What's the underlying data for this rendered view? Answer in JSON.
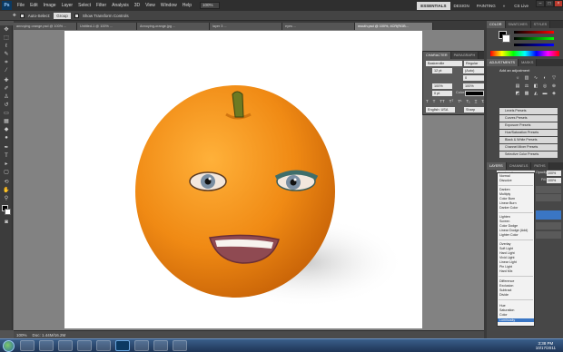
{
  "menu": {
    "app_logo": "Ps",
    "items": [
      "File",
      "Edit",
      "Image",
      "Layer",
      "Select",
      "Filter",
      "Analysis",
      "3D",
      "View",
      "Window",
      "Help"
    ],
    "zoom": "100%",
    "workspaces": [
      "ESSENTIALS",
      "DESIGN",
      "PAINTING"
    ],
    "cs_live": "CS Live"
  },
  "options": {
    "auto_select_label": "Auto-Select:",
    "auto_select_value": "Group",
    "show_transform": "Show Transform Controls"
  },
  "tabs": [
    "annoying orange.psd @ 100% ...",
    "Untitled-1 @ 100% ...",
    "Annoying-orange.jpg ...",
    "layer 3 ...",
    "eyes ...",
    "mouth.psd @ 100%, 4CR(RGB..."
  ],
  "status": {
    "zoom": "100%",
    "doc": "Doc: 1.44M/16.2M"
  },
  "panels": {
    "color_tabs": [
      "COLOR",
      "SWATCHES",
      "STYLES"
    ],
    "adjustments_tabs": [
      "ADJUSTMENTS",
      "MASKS"
    ],
    "adjustments_title": "Add an adjustment",
    "presets": [
      "Levels Presets",
      "Curves Presets",
      "Exposure Presets",
      "Hue/Saturation Presets",
      "Black & White Presets",
      "Channel Mixer Presets",
      "Selective Color Presets"
    ],
    "layers_tabs": [
      "LAYERS",
      "CHANNELS",
      "PATHS"
    ],
    "blend_current": "Luminosity",
    "opacity_label": "Opacity:",
    "opacity_value": "100%",
    "fill_label": "Fill:",
    "fill_value": "100%"
  },
  "character": {
    "tabs": [
      "CHARACTER",
      "PARAGRAPH"
    ],
    "font": "Baskerville",
    "style": "Regular",
    "size": "12 pt",
    "leading": "(Auto)",
    "tracking": "0",
    "scale_v": "100%",
    "scale_h": "100%",
    "baseline": "0 pt",
    "color_label": "Color:",
    "language": "English: USA",
    "aa": "Sharp"
  },
  "blend_modes": [
    [
      "Normal",
      "Dissolve"
    ],
    [
      "Darken",
      "Multiply",
      "Color Burn",
      "Linear Burn",
      "Darker Color"
    ],
    [
      "Lighten",
      "Screen",
      "Color Dodge",
      "Linear Dodge (Add)",
      "Lighter Color"
    ],
    [
      "Overlay",
      "Soft Light",
      "Hard Light",
      "Vivid Light",
      "Linear Light",
      "Pin Light",
      "Hard Mix"
    ],
    [
      "Difference",
      "Exclusion",
      "Subtract",
      "Divide"
    ],
    [
      "Hue",
      "Saturation",
      "Color",
      "Luminosity"
    ]
  ],
  "taskbar": {
    "time": "3:38 PM",
    "date": "10/17/2011"
  },
  "colors": {
    "orange": "#f08a14",
    "stem": "#5b6b1f",
    "accent": "#3a76c4"
  }
}
